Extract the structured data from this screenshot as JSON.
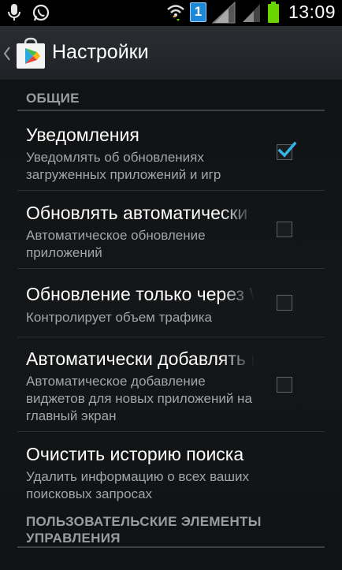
{
  "status_bar": {
    "time": "13:09",
    "notification_badge": "1",
    "icons": [
      "microphone-icon",
      "whatsapp-icon",
      "wifi-icon",
      "sim-badge-icon",
      "signal-icon",
      "signal-icon-2",
      "battery-icon"
    ],
    "battery_color": "#6ad400"
  },
  "action_bar": {
    "title": "Настройки",
    "app_icon": "play-store-icon"
  },
  "sections": [
    {
      "header": "ОБЩИЕ",
      "items": [
        {
          "title": "Уведомления",
          "summary": "Уведомлять об обновлениях загруженных приложений и игр",
          "checked": true
        },
        {
          "title": "Обновлять автоматически",
          "summary": "Автоматическое обновление приложений",
          "checked": false
        },
        {
          "title": "Обновление только через Wi-Fi",
          "summary": "Контролирует объем трафика",
          "checked": false
        },
        {
          "title": "Автоматически добавлять виджеты",
          "summary": "Автоматическое добавление виджетов для новых приложений на главный экран",
          "checked": false
        },
        {
          "title": "Очистить историю поиска",
          "summary": "Удалить информацию о всех ваших поисковых запросах"
        }
      ]
    },
    {
      "header": "ПОЛЬЗОВАТЕЛЬСКИЕ ЭЛЕМЕНТЫ УПРАВЛЕНИЯ"
    }
  ],
  "colors": {
    "accent_blue": "#33b5e5",
    "background": "#141618"
  }
}
